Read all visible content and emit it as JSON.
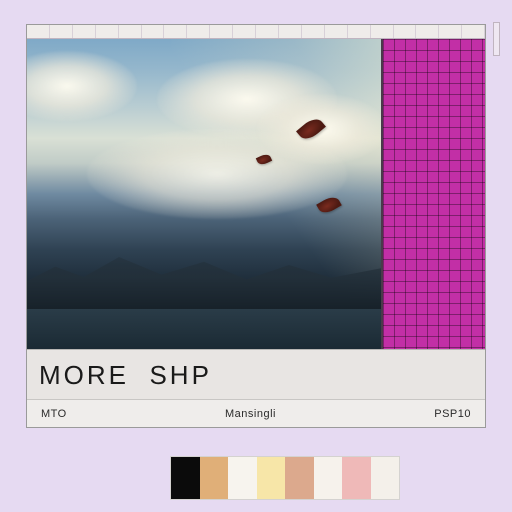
{
  "title": {
    "segment_a": "MORE",
    "segment_b": "SHP"
  },
  "footer": {
    "left": "MTO",
    "center": "Mansingli",
    "right": "PSP10"
  },
  "swatches": [
    "#0b0b0b",
    "#e0af78",
    "#f7f4ee",
    "#f7e6a8",
    "#dca98d",
    "#f6f2ec",
    "#efb9b8",
    "#f4f0ea"
  ],
  "colors": {
    "grid_panel": "#c22fa6",
    "workspace_bg": "#e6e4e2",
    "app_bg": "#e6daf2"
  },
  "icons": {
    "leaf": "leaf-icon"
  }
}
